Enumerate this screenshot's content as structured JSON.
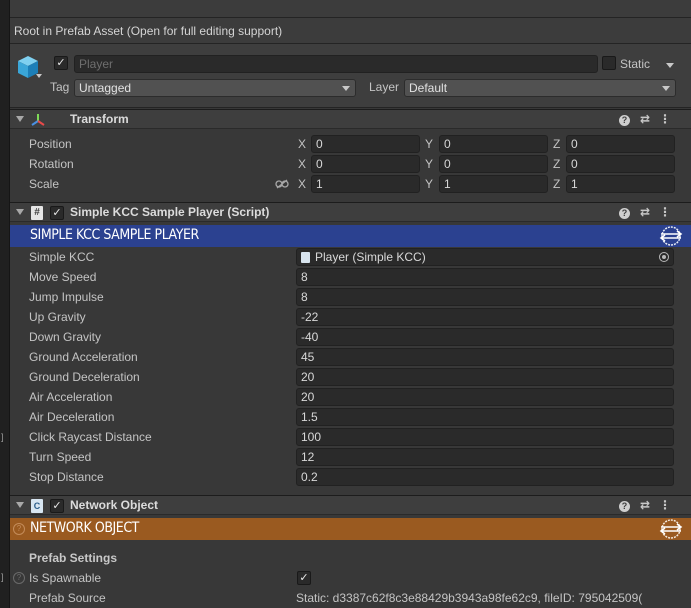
{
  "prefab_bar": {
    "text": "Root in Prefab Asset (Open for full editing support)"
  },
  "game_object": {
    "name_placeholder": "Player",
    "static_label": "Static",
    "tag_label": "Tag",
    "tag_value": "Untagged",
    "layer_label": "Layer",
    "layer_value": "Default",
    "active": true
  },
  "transform": {
    "title": "Transform",
    "rows": [
      {
        "label": "Position",
        "x": "0",
        "y": "0",
        "z": "0"
      },
      {
        "label": "Rotation",
        "x": "0",
        "y": "0",
        "z": "0"
      },
      {
        "label": "Scale",
        "x": "1",
        "y": "1",
        "z": "1"
      }
    ],
    "axis_labels": {
      "x": "X",
      "y": "Y",
      "z": "Z"
    }
  },
  "kcc_script": {
    "title": "Simple KCC Sample Player (Script)",
    "banner": "SIMPLE KCC SAMPLE PLAYER",
    "banner_color": "#2b4190",
    "simple_kcc_label": "Simple KCC",
    "simple_kcc_value": "Player (Simple KCC)",
    "fields": [
      {
        "label": "Move Speed",
        "value": "8"
      },
      {
        "label": "Jump Impulse",
        "value": "8"
      },
      {
        "label": "Up Gravity",
        "value": "-22"
      },
      {
        "label": "Down Gravity",
        "value": "-40"
      },
      {
        "label": "Ground Acceleration",
        "value": "45"
      },
      {
        "label": "Ground Deceleration",
        "value": "20"
      },
      {
        "label": "Air Acceleration",
        "value": "20"
      },
      {
        "label": "Air Deceleration",
        "value": "1.5"
      },
      {
        "label": "Click Raycast Distance",
        "value": "100"
      },
      {
        "label": "Turn Speed",
        "value": "12"
      },
      {
        "label": "Stop Distance",
        "value": "0.2"
      }
    ]
  },
  "network_object": {
    "title": "Network Object",
    "banner": "NETWORK OBJECT",
    "banner_color": "#9a5a20",
    "prefab_settings_label": "Prefab Settings",
    "is_spawnable_label": "Is Spawnable",
    "is_spawnable": true,
    "prefab_source_label": "Prefab Source",
    "prefab_source_value": "Static: d3387c62f8c3e88429b3943a98fe62c9, fileID: 795042509("
  },
  "icons": [
    "cube-icon",
    "transform-icon",
    "script-icon",
    "network-object-icon",
    "help-icon",
    "presets-icon",
    "kebab-menu-icon",
    "link-icon",
    "photon-logo-icon",
    "object-picker-icon"
  ]
}
